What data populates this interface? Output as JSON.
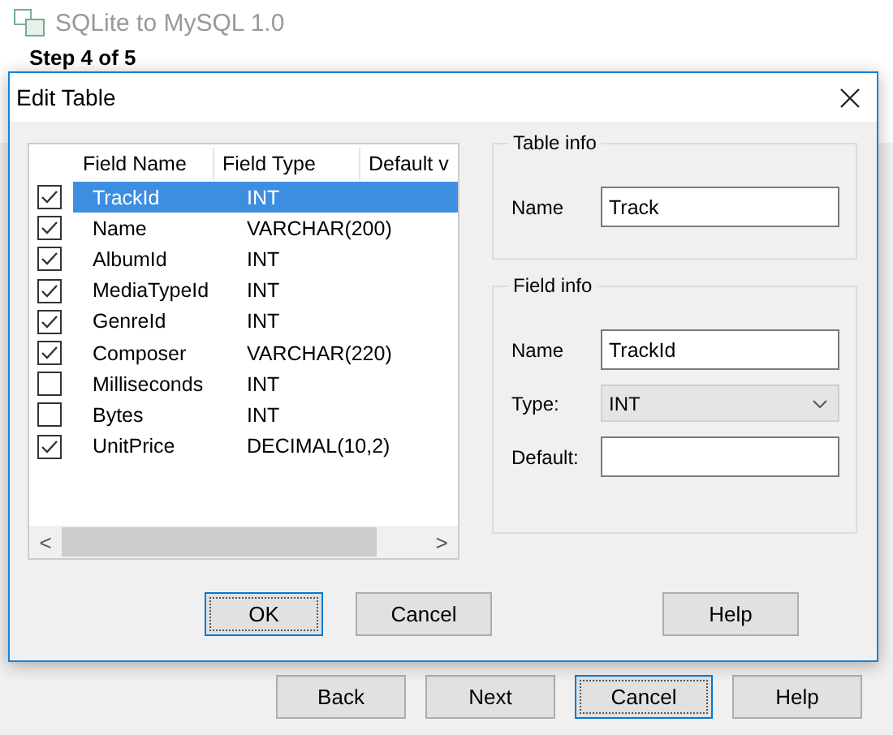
{
  "window": {
    "title": "SQLite to MySQL 1.0",
    "step": "Step 4 of 5"
  },
  "dialog": {
    "title": "Edit Table",
    "list": {
      "columns": [
        "Field Name",
        "Field Type",
        "Default v"
      ],
      "rows": [
        {
          "checked": true,
          "selected": true,
          "name": "TrackId",
          "type": "INT"
        },
        {
          "checked": true,
          "selected": false,
          "name": "Name",
          "type": "VARCHAR(200)"
        },
        {
          "checked": true,
          "selected": false,
          "name": "AlbumId",
          "type": "INT"
        },
        {
          "checked": true,
          "selected": false,
          "name": "MediaTypeId",
          "type": "INT"
        },
        {
          "checked": true,
          "selected": false,
          "name": "GenreId",
          "type": "INT"
        },
        {
          "checked": true,
          "selected": false,
          "name": "Composer",
          "type": "VARCHAR(220)"
        },
        {
          "checked": false,
          "selected": false,
          "name": "Milliseconds",
          "type": "INT"
        },
        {
          "checked": false,
          "selected": false,
          "name": "Bytes",
          "type": "INT"
        },
        {
          "checked": true,
          "selected": false,
          "name": "UnitPrice",
          "type": "DECIMAL(10,2)"
        }
      ],
      "scroll_left": "<",
      "scroll_right": ">"
    },
    "table_info": {
      "title": "Table info",
      "name_label": "Name",
      "name_value": "Track"
    },
    "field_info": {
      "title": "Field info",
      "name_label": "Name",
      "name_value": "TrackId",
      "type_label": "Type:",
      "type_value": "INT",
      "default_label": "Default:"
    },
    "buttons": [
      {
        "label": "OK",
        "focused": true
      },
      {
        "label": "Cancel",
        "focused": false
      },
      {
        "label": "Help",
        "focused": false
      }
    ]
  },
  "wizard_buttons": [
    {
      "label": "Back",
      "focused": false
    },
    {
      "label": "Next",
      "focused": false
    },
    {
      "label": "Cancel",
      "focused": true
    },
    {
      "label": "Help",
      "focused": false
    }
  ]
}
